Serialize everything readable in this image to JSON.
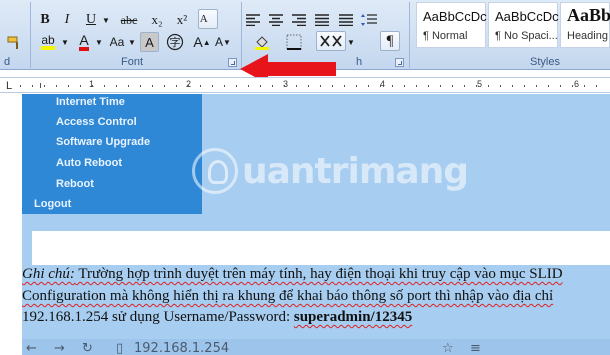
{
  "ribbon": {
    "font_group_label": "Font",
    "paragraph_group_label_fragment": "h",
    "styles_group_label": "Styles",
    "clipboard_label_fragment": "d",
    "bold": "B",
    "italic": "I",
    "underline": "U",
    "strikethrough": "abc",
    "subscript": "x₂",
    "superscript": "x²",
    "change_case": "Aa",
    "char_shading": "A",
    "grow_font": "A",
    "shrink_font": "A",
    "font_color": "A",
    "highlight": "ab",
    "paragraph_mark": "¶",
    "colors": {
      "font_color": "#e01010",
      "highlight": "#f5f500"
    }
  },
  "styles": [
    {
      "sample": "AaBbCcDc",
      "name": "¶ Normal"
    },
    {
      "sample": "AaBbCcDc",
      "name": "¶ No Spaci..."
    },
    {
      "sample": "AaBb",
      "name": "Heading"
    }
  ],
  "ruler": {
    "numbers": [
      "1",
      "2",
      "3",
      "4",
      "5",
      "6"
    ]
  },
  "menu": {
    "items": [
      "Internet Time",
      "Access Control",
      "Software Upgrade",
      "Auto Reboot",
      "Reboot"
    ],
    "logout": "Logout",
    "panel_color": "#2f88d6"
  },
  "watermark": {
    "text": "uantrimang"
  },
  "document": {
    "line1_label": "Ghi chú:",
    "line1_text": " Trường hợp trình duyệt trên máy tính, hay điện thoại khi truy cập vào mục SLID",
    "line2_text": "Configuration mà không hiển thị ra khung để khai báo thông số port thì nhập vào địa chỉ",
    "line3_text": "192.168.1.254 sử dụng Username/Password: ",
    "line3_bold": "superadmin/12345",
    "browser_url": "192.168.1.254",
    "selection_color": "#a7cdf0"
  },
  "arrow_color": "#e8141b"
}
